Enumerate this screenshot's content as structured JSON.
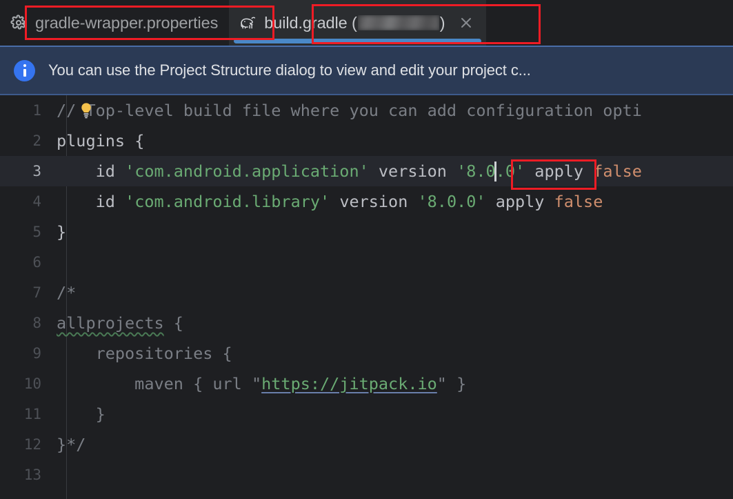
{
  "window": {
    "theme_background": "#1e1f22",
    "accent_color": "#3574f0",
    "annotation_color": "#ee1c25"
  },
  "tabs": [
    {
      "label": "gradle-wrapper.properties",
      "icon": "gear-icon",
      "active": false,
      "highlighted": true
    },
    {
      "label_prefix": "build.gradle (",
      "label_redacted": "物",
      "label_suffix": ")",
      "icon": "gradle-elephant-icon",
      "active": true,
      "highlighted": true,
      "close_icon": "close-icon"
    }
  ],
  "notification": {
    "icon": "info-icon",
    "message": "You can use the Project Structure dialog to view and edit your project c..."
  },
  "editor": {
    "current_line": 3,
    "intention_icon": "lightbulb-icon",
    "lines": [
      {
        "n": "1",
        "current": false,
        "tokens": [
          {
            "t": "// Top-level build file where you can add configuration opti",
            "c": "comment"
          }
        ]
      },
      {
        "n": "2",
        "current": false,
        "tokens": [
          {
            "t": "plugins",
            "c": "plain"
          },
          {
            "t": " {",
            "c": "plain"
          }
        ]
      },
      {
        "n": "3",
        "current": true,
        "tokens": [
          {
            "t": "    id ",
            "c": "plain"
          },
          {
            "t": "'com.android.application'",
            "c": "string"
          },
          {
            "t": " version ",
            "c": "plain"
          },
          {
            "t": "'8.0",
            "c": "string"
          },
          {
            "t": "CARET",
            "c": "caret"
          },
          {
            "t": ".0'",
            "c": "string"
          },
          {
            "t": " apply ",
            "c": "plain"
          },
          {
            "t": "false",
            "c": "kw"
          }
        ]
      },
      {
        "n": "4",
        "current": false,
        "tokens": [
          {
            "t": "    id ",
            "c": "plain"
          },
          {
            "t": "'com.android.library'",
            "c": "string"
          },
          {
            "t": " version ",
            "c": "plain"
          },
          {
            "t": "'8.0.0'",
            "c": "string"
          },
          {
            "t": " apply ",
            "c": "plain"
          },
          {
            "t": "false",
            "c": "kw"
          }
        ]
      },
      {
        "n": "5",
        "current": false,
        "tokens": [
          {
            "t": "}",
            "c": "plain"
          }
        ]
      },
      {
        "n": "6",
        "current": false,
        "tokens": []
      },
      {
        "n": "7",
        "current": false,
        "tokens": [
          {
            "t": "/*",
            "c": "comment"
          }
        ]
      },
      {
        "n": "8",
        "current": false,
        "tokens": [
          {
            "t": "allprojects",
            "c": "squiggly"
          },
          {
            "t": " {",
            "c": "comment"
          }
        ]
      },
      {
        "n": "9",
        "current": false,
        "tokens": [
          {
            "t": "    repositories {",
            "c": "comment"
          }
        ]
      },
      {
        "n": "10",
        "current": false,
        "tokens": [
          {
            "t": "        maven { url \"",
            "c": "comment"
          },
          {
            "t": "https://jitpack.io",
            "c": "link"
          },
          {
            "t": "\" }",
            "c": "comment"
          }
        ]
      },
      {
        "n": "11",
        "current": false,
        "tokens": [
          {
            "t": "    }",
            "c": "comment"
          }
        ]
      },
      {
        "n": "12",
        "current": false,
        "tokens": [
          {
            "t": "}*/",
            "c": "comment"
          }
        ]
      },
      {
        "n": "13",
        "current": false,
        "tokens": []
      }
    ]
  },
  "annotations": [
    {
      "name": "annotation-box-tab-gradle-wrapper",
      "target": "gradle-wrapper.properties"
    },
    {
      "name": "annotation-box-tab-build-gradle",
      "target": "build.gradle"
    },
    {
      "name": "annotation-box-version-string",
      "target": "'8.0.0'"
    }
  ]
}
